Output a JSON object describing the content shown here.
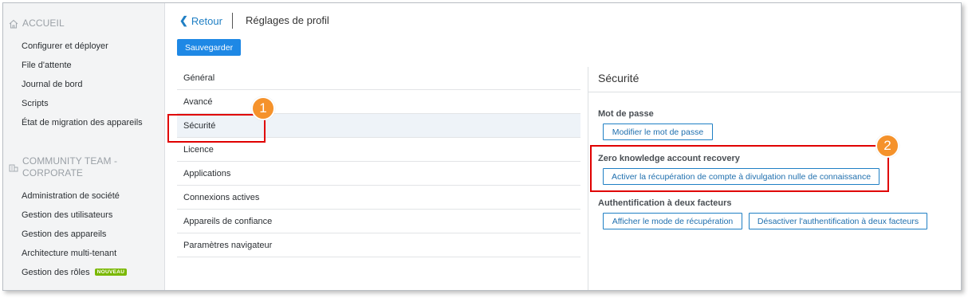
{
  "sidebar": {
    "section1": {
      "title": "ACCUEIL",
      "icon": "home-icon"
    },
    "items1": [
      "Configurer et déployer",
      "File d'attente",
      "Journal de bord",
      "Scripts",
      "État de migration des appareils"
    ],
    "section2": {
      "title_line1": "COMMUNITY TEAM -",
      "title_line2": "CORPORATE",
      "icon": "building-icon"
    },
    "items2": [
      "Administration de société",
      "Gestion des utilisateurs",
      "Gestion des appareils",
      "Architecture multi-tenant",
      "Gestion des rôles"
    ],
    "badge": "NOUVEAU"
  },
  "header": {
    "back_label": "Retour",
    "page_title": "Réglages de profil",
    "save_label": "Sauvegarder"
  },
  "menu": {
    "items": [
      "Général",
      "Avancé",
      "Sécurité",
      "Licence",
      "Applications",
      "Connexions actives",
      "Appareils de confiance",
      "Paramètres navigateur"
    ],
    "selected": "Sécurité"
  },
  "security": {
    "title": "Sécurité",
    "password_label": "Mot de passe",
    "change_password_button": "Modifier le mot de passe",
    "zk_label": "Zero knowledge account recovery",
    "zk_button": "Activer la récupération de compte à divulgation nulle de connaissance",
    "twofa_label": "Authentification à deux facteurs",
    "show_recovery_button": "Afficher le mode de récupération",
    "disable_2fa_button": "Désactiver l'authentification à deux facteurs"
  },
  "callouts": [
    "1",
    "2"
  ],
  "colors": {
    "accent": "#1e88e5",
    "callout": "#f5922b",
    "highlight": "#e00000",
    "badge": "#7ab800"
  }
}
